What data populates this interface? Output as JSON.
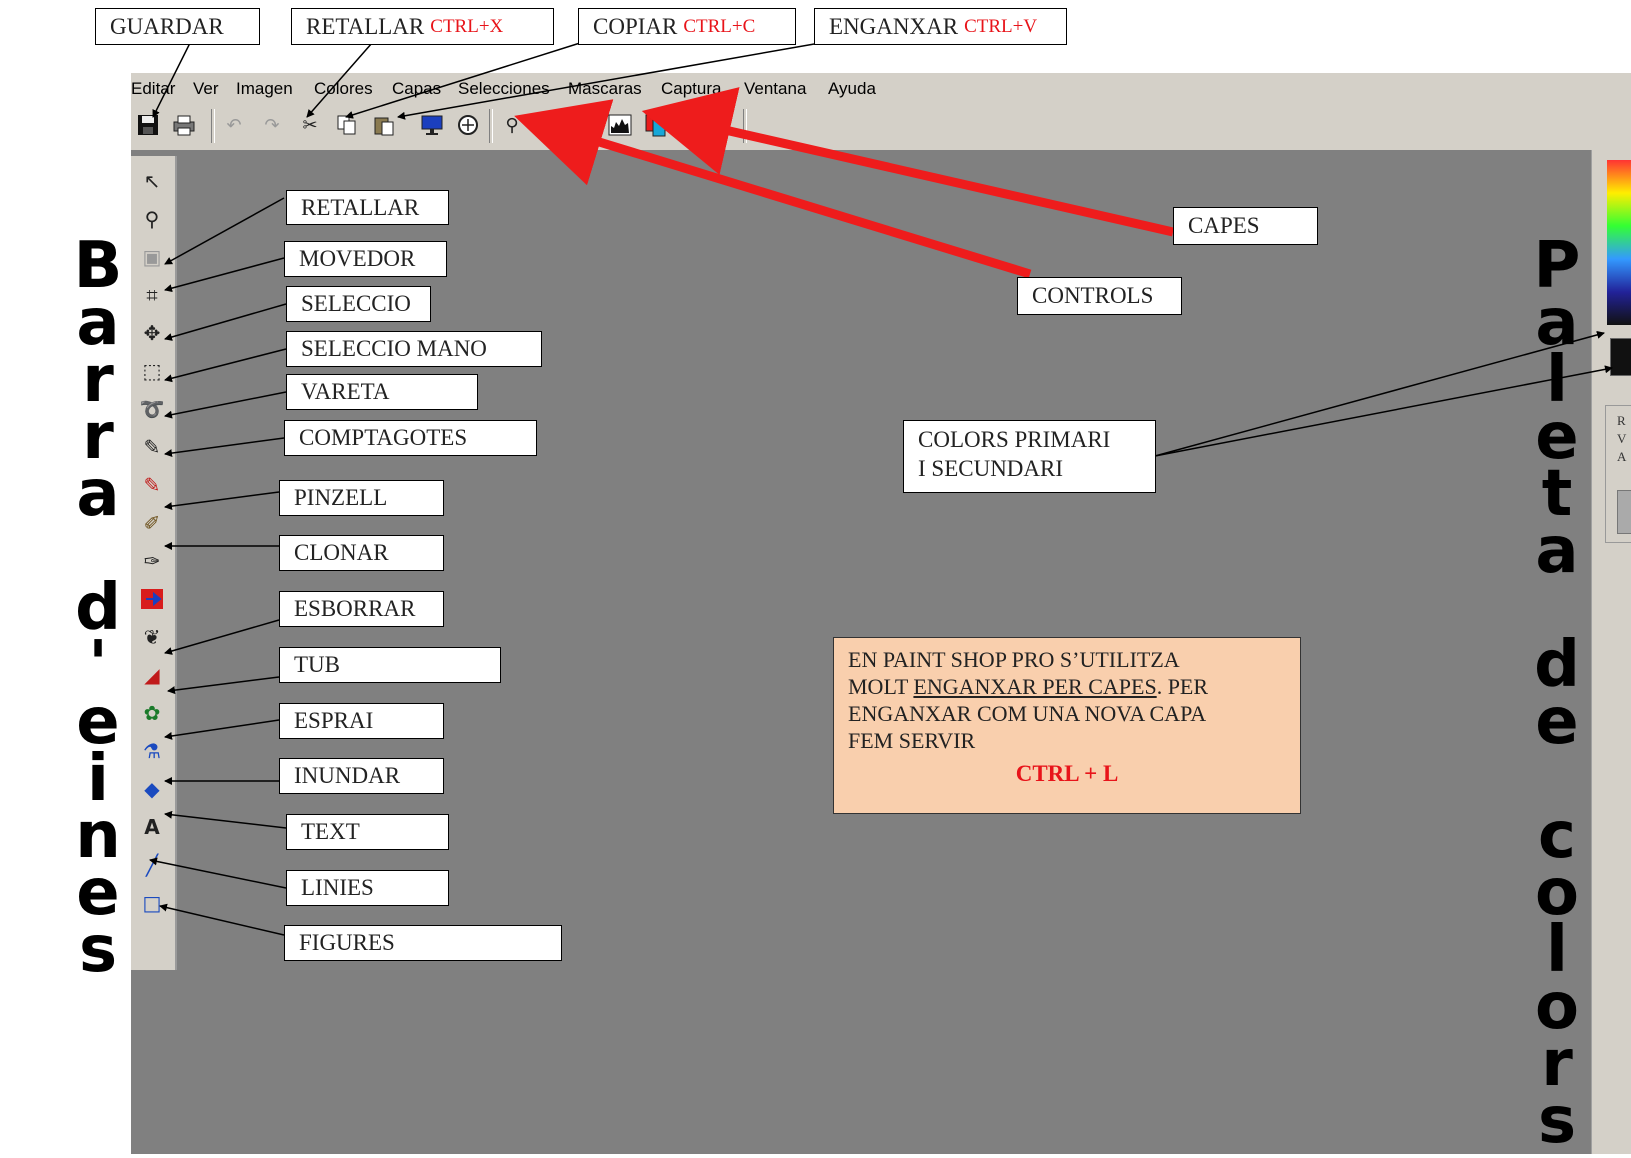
{
  "menubar": [
    "Editar",
    "Ver",
    "Imagen",
    "Colores",
    "Capas",
    "Selecciones",
    "Mascaras",
    "Captura",
    "Ventana",
    "Ayuda"
  ],
  "top_labels": {
    "guardar": "GUARDAR",
    "retallar": "RETALLAR",
    "retallar_shortcut": "CTRL+X",
    "copiar": "COPIAR",
    "copiar_shortcut": "CTRL+C",
    "enganxar": "ENGANXAR",
    "enganxar_shortcut": "CTRL+V"
  },
  "toolbar_icons": [
    "save-icon",
    "print-icon",
    "undo-icon",
    "redo-icon",
    "cut-icon",
    "copy-icon",
    "paste-icon",
    "monitor-icon",
    "browse-icon",
    "zoom-icon",
    "controls-icon",
    "histogram-icon",
    "chart-icon",
    "layers-icon",
    "help-icon"
  ],
  "tool_labels": [
    "RETALLAR",
    "MOVEDOR",
    "SELECCIO",
    "SELECCIO MANO",
    "VARETA",
    "COMPTAGOTES",
    "PINZELL",
    "CLONAR",
    "ESBORRAR",
    "TUB",
    "ESPRAI",
    "INUNDAR",
    "TEXT",
    "LINIES",
    "FIGURES"
  ],
  "right_labels": {
    "capes": "CAPES",
    "controls": "CONTROLS",
    "colors_line1": "COLORS PRIMARI",
    "colors_line2": "I SECUNDARI"
  },
  "note": {
    "line1": "EN PAINT SHOP PRO S’UTILITZA",
    "line2_prefix": "MOLT ",
    "line2_underlined": "ENGANXAR PER CAPES",
    "line2_suffix": ". PER",
    "line3": "ENGANXAR COM UNA NOVA CAPA",
    "line4": "FEM SERVIR",
    "shortcut": "CTRL + L"
  },
  "vertical_left": "Barra d'eines",
  "vertical_right": "Paleta de colors",
  "palette_letters": [
    "R",
    "V",
    "A"
  ],
  "colors": {
    "arrow_red": "#ee1c1c",
    "workspace": "#808080",
    "shortcut_red": "#e8141a",
    "note_bg": "#f9cfad"
  }
}
